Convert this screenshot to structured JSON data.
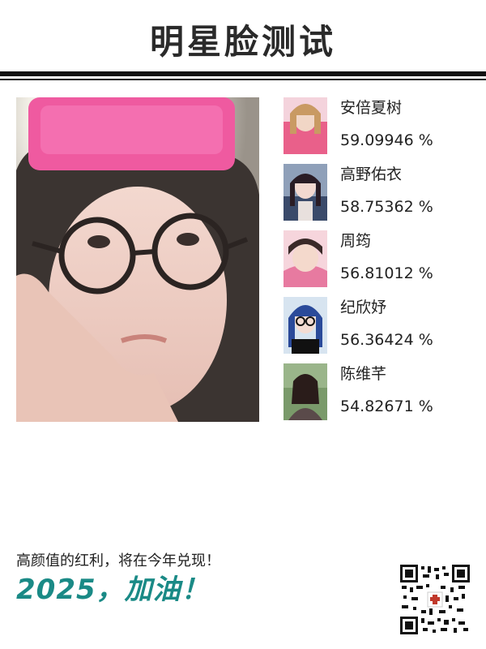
{
  "header": {
    "title": "明星脸测试"
  },
  "main_photo": {
    "description_icon": "user-photo"
  },
  "matches": [
    {
      "name": "安倍夏树",
      "score": "59.09946 %",
      "thumb_color": "#e9608a"
    },
    {
      "name": "高野佑衣",
      "score": "58.75362 %",
      "thumb_color": "#3a4a6a"
    },
    {
      "name": "周筠",
      "score": "56.81012 %",
      "thumb_color": "#e7a9b4"
    },
    {
      "name": "纪欣妤",
      "score": "56.36424 %",
      "thumb_color": "#2a4a9a"
    },
    {
      "name": "陈维芊",
      "score": "54.82671 %",
      "thumb_color": "#4a6a3a"
    }
  ],
  "footer": {
    "slogan": "高颜值的红利，将在今年兑现！",
    "big_text": "2025，加油！"
  },
  "colors": {
    "accent": "#1a8a86",
    "rule": "#111111"
  }
}
